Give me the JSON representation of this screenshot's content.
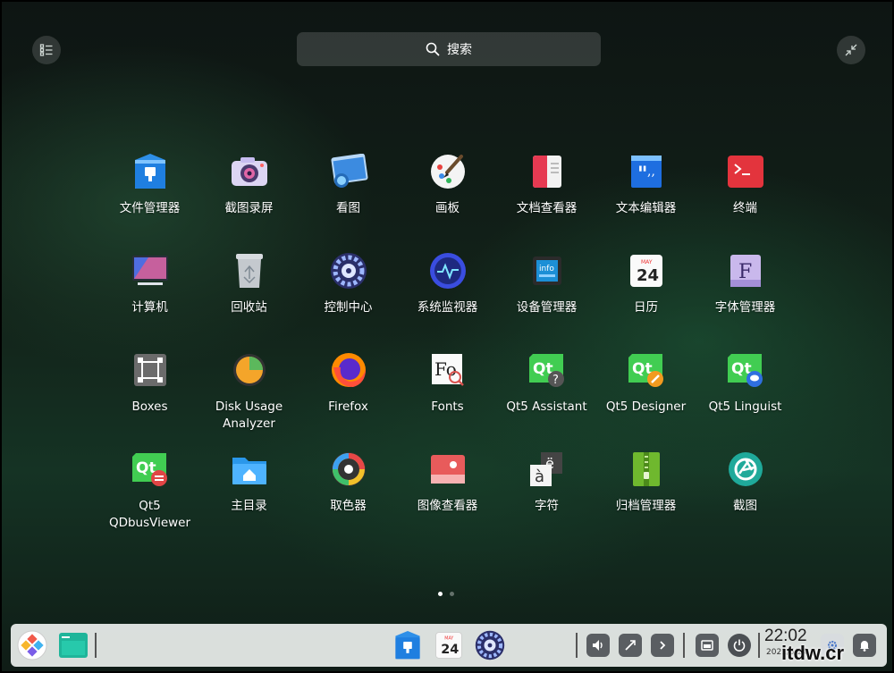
{
  "search": {
    "label": "搜索"
  },
  "apps": [
    {
      "label": "文件管理器",
      "icon": "file-manager-icon"
    },
    {
      "label": "截图录屏",
      "icon": "camera-icon"
    },
    {
      "label": "看图",
      "icon": "image-viewer-icon"
    },
    {
      "label": "画板",
      "icon": "draw-icon"
    },
    {
      "label": "文档查看器",
      "icon": "document-viewer-icon"
    },
    {
      "label": "文本编辑器",
      "icon": "text-editor-icon"
    },
    {
      "label": "终端",
      "icon": "terminal-icon"
    },
    {
      "label": "计算机",
      "icon": "computer-icon"
    },
    {
      "label": "回收站",
      "icon": "trash-icon"
    },
    {
      "label": "控制中心",
      "icon": "control-center-icon"
    },
    {
      "label": "系统监视器",
      "icon": "system-monitor-icon"
    },
    {
      "label": "设备管理器",
      "icon": "device-manager-icon"
    },
    {
      "label": "日历",
      "icon": "calendar-icon"
    },
    {
      "label": "字体管理器",
      "icon": "font-manager-icon"
    },
    {
      "label": "Boxes",
      "icon": "boxes-icon"
    },
    {
      "label": "Disk Usage Analyzer",
      "icon": "disk-usage-icon"
    },
    {
      "label": "Firefox",
      "icon": "firefox-icon"
    },
    {
      "label": "Fonts",
      "icon": "fonts-icon"
    },
    {
      "label": "Qt5 Assistant",
      "icon": "qt-assistant-icon"
    },
    {
      "label": "Qt5 Designer",
      "icon": "qt-designer-icon"
    },
    {
      "label": "Qt5 Linguist",
      "icon": "qt-linguist-icon"
    },
    {
      "label": "Qt5 QDbusViewer",
      "icon": "qt-dbusviewer-icon"
    },
    {
      "label": "主目录",
      "icon": "home-folder-icon"
    },
    {
      "label": "取色器",
      "icon": "color-picker-icon"
    },
    {
      "label": "图像查看器",
      "icon": "image-viewer-2-icon"
    },
    {
      "label": "字符",
      "icon": "characters-icon"
    },
    {
      "label": "归档管理器",
      "icon": "archive-manager-icon"
    },
    {
      "label": "截图",
      "icon": "screenshot-icon"
    }
  ],
  "calendar_icon": {
    "month": "MAY",
    "day": "24"
  },
  "device_icon": {
    "text": "info"
  },
  "font_icon": {
    "letter": "F"
  },
  "fonts_icon": {
    "letter": "Fo"
  },
  "characters_icon": {
    "main": "à",
    "sub": "ë"
  },
  "qt_icon": {
    "text": "Qt"
  },
  "clock": {
    "time": "22:02",
    "date": "2021/5/24"
  },
  "watermark": "itdw.cr",
  "colors": {
    "accent": "#2ca7f8",
    "dock_bg": "#eceeee",
    "qt_green": "#41cd52"
  }
}
